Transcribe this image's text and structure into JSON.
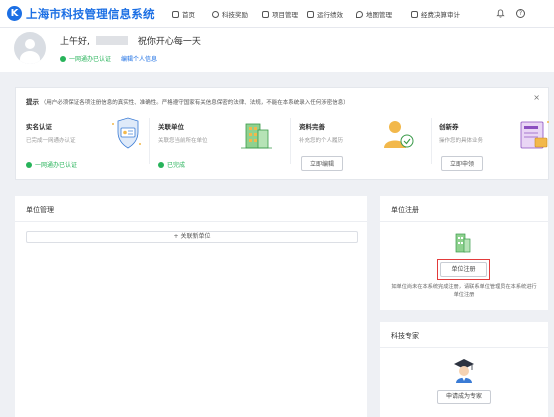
{
  "app": {
    "logo_letter": "K",
    "title": "上海市科技管理信息系统"
  },
  "nav": {
    "items": [
      {
        "label": "首页",
        "icon": "home-icon"
      },
      {
        "label": "科技奖励",
        "icon": "trophy-icon"
      },
      {
        "label": "项目管理",
        "icon": "project-icon"
      },
      {
        "label": "运行绩效",
        "icon": "performance-icon"
      },
      {
        "label": "地图管理",
        "icon": "map-icon"
      },
      {
        "label": "经费决算审计",
        "icon": "audit-icon"
      }
    ],
    "bell_icon": "bell-icon",
    "help_label": "?"
  },
  "greeting": {
    "text_before": "上午好,",
    "text_after": "祝你开心每一天",
    "verified_label": "一网通办已认证",
    "edit_link": "编辑个人信息",
    "status_color": "#27b35a"
  },
  "notice": {
    "prefix": "提示",
    "text": "（用户必须保证各项注册信息的真实性、准确性。严格遵守国家有关信息保密的法律、法规，不能在本系统录入任何涉密信息）",
    "close": "×",
    "tasks": [
      {
        "title": "实名认证",
        "desc": "已完成一网通办认证",
        "status": "一网通办已认证",
        "art": "shield-id-illustration"
      },
      {
        "title": "关联单位",
        "desc": "关联您当前所在单位",
        "status": "已完成",
        "art": "building-illustration"
      },
      {
        "title": "资料完善",
        "desc": "补充您的个人履历",
        "button": "立即编辑",
        "art": "profile-illustration"
      },
      {
        "title": "创新券",
        "desc": "操作您的具体业务",
        "button": "立即申领",
        "art": "voucher-illustration"
      }
    ]
  },
  "unit_mgmt": {
    "title": "单位管理",
    "add_button": "+ 关联新单位"
  },
  "unit_register": {
    "title": "单位注册",
    "button": "单位注册",
    "note": "如单位尚未在本系统完成注册，请联系单位管理员在本系统进行单位注册",
    "highlight_color": "#e23b3b"
  },
  "expert": {
    "title": "科技专家",
    "button": "申请成为专家"
  },
  "colors": {
    "brand": "#1c6fe4",
    "success": "#27b35a",
    "background": "#eef0f4"
  }
}
